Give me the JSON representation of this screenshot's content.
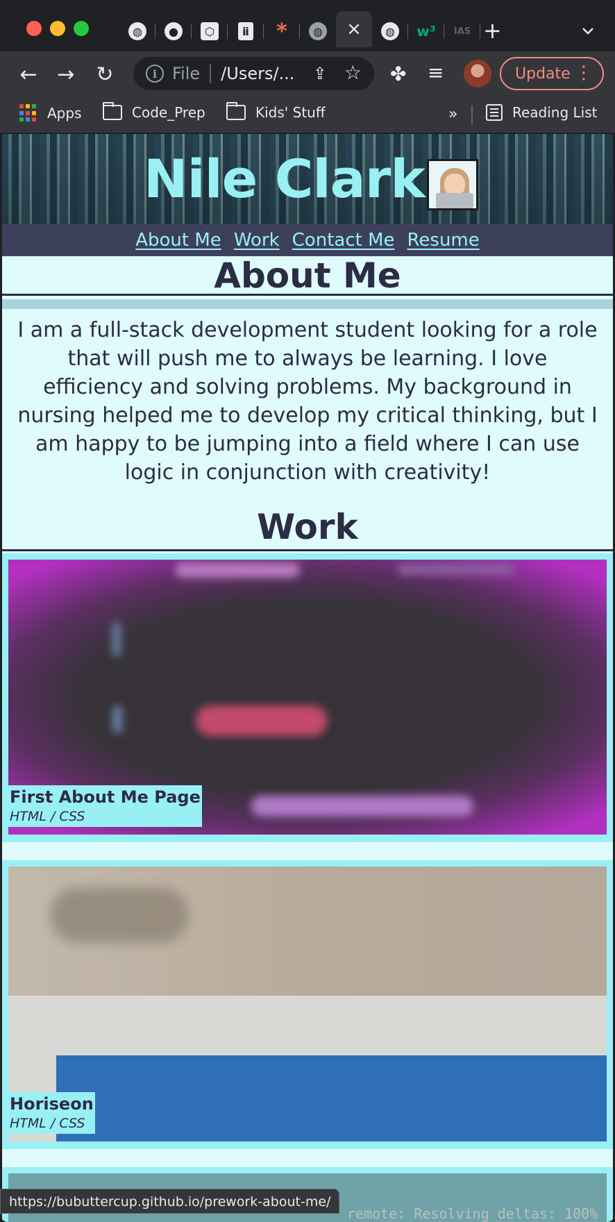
{
  "browser": {
    "active_tab_close": "×",
    "tab_icons": [
      "globe-icon",
      "github-icon",
      "codepen-icon",
      "doc-icon",
      "asterisk-icon",
      "globe-icon",
      "close-icon",
      "globe-icon",
      "w3-icon",
      "ias-icon"
    ],
    "new_tab": "+",
    "address_scheme": "File",
    "address_url": "/Users/...",
    "update_label": "Update",
    "bookmarks": [
      {
        "label": "Apps",
        "icon": "apps-grid-icon"
      },
      {
        "label": "Code_Prep",
        "icon": "folder-icon"
      },
      {
        "label": "Kids' Stuff",
        "icon": "folder-icon"
      }
    ],
    "bookmarks_more": "»",
    "reading_list": "Reading List",
    "status_url": "https://bubuttercup.github.io/prework-about-me/",
    "terminal_text": "remote: Resolving deltas: 100%"
  },
  "site": {
    "title": "Nile Clark",
    "nav": [
      "About Me",
      "Work",
      "Contact Me",
      "Resume"
    ],
    "about_heading": "About Me",
    "about_text": "I am a full-stack development student looking for a role that will push me to always be learning. I love efficiency and solving problems. My background in nursing helped me to develop my critical thinking, but I am happy to be jumping into a field where I can use logic in conjunction with creativity!",
    "work_heading": "Work",
    "projects": [
      {
        "title": "First About Me Page",
        "tech": "HTML / CSS"
      },
      {
        "title": "Horiseon",
        "tech": "HTML / CSS"
      }
    ]
  },
  "colors": {
    "accent": "#98f0f5",
    "nav_bg": "#3d405b",
    "page_bg": "#e0fbfc",
    "text": "#2c2c44",
    "update": "#f28b82"
  }
}
